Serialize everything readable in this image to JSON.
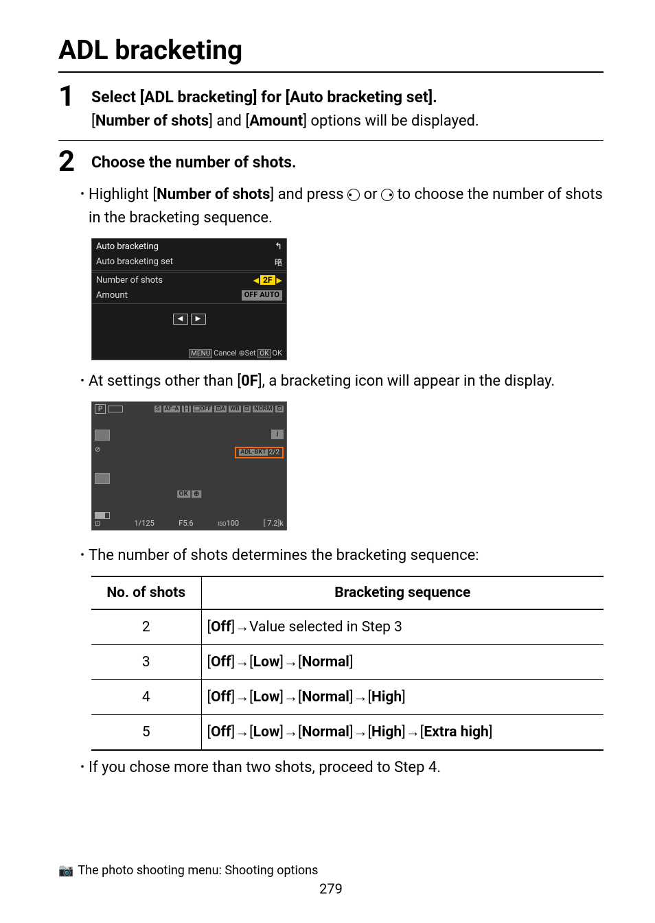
{
  "title": "ADL bracketing",
  "steps": [
    {
      "num": "1",
      "label": "Select [ADL bracketing] for [Auto bracketing set].",
      "body_prefix": "[",
      "body_b1": "Number of shots",
      "body_mid": "] and [",
      "body_b2": "Amount",
      "body_suffix": "] options will be displayed."
    },
    {
      "num": "2",
      "label": "Choose the number of shots.",
      "bullet1_prefix": "Highlight [",
      "bullet1_b": "Number of shots",
      "bullet1_mid": "] and press ",
      "bullet1_or": " or ",
      "bullet1_suffix": " to choose the number of shots in the bracketing sequence.",
      "bullet2_prefix": "At settings other than [",
      "bullet2_b": "0F",
      "bullet2_suffix": "], a bracketing icon will appear in the display.",
      "bullet3": "The number of shots determines the bracketing sequence:",
      "bullet4": "If you chose more than two shots, proceed to Step 4."
    }
  ],
  "menu": {
    "title": "Auto bracketing",
    "set_label": "Auto bracketing set",
    "shots_label": "Number of shots",
    "shots_value": "2F",
    "amount_label": "Amount",
    "amount_value": "OFF AUTO",
    "cancel": "Cancel",
    "set": "Set",
    "ok": "OK"
  },
  "cam": {
    "mode": "P",
    "afa": "AF-A",
    "s": "S",
    "norm": "NORM",
    "wb": "WB",
    "bkt": "ADL-BKT",
    "bkt_count": "2/2",
    "shutter": "1/125",
    "aperture": "F5.6",
    "iso_label": "ISO",
    "iso": "100",
    "remaining": "[ 7.2]k",
    "ok": "OK"
  },
  "table": {
    "head_shots": "No. of shots",
    "head_seq": "Bracketing sequence",
    "rows": [
      {
        "n": "2",
        "seq": "[**Off**]→Value selected in Step 3"
      },
      {
        "n": "3",
        "seq": "[**Off**]→[**Low**]→[**Normal**]"
      },
      {
        "n": "4",
        "seq": "[**Off**]→[**Low**]→[**Normal**]→[**High**]"
      },
      {
        "n": "5",
        "seq": "[**Off**]→[**Low**]→[**Normal**]→[**High**]→[**Extra high**]"
      }
    ]
  },
  "footer": {
    "text": "The photo shooting menu: Shooting options",
    "page": "279"
  }
}
